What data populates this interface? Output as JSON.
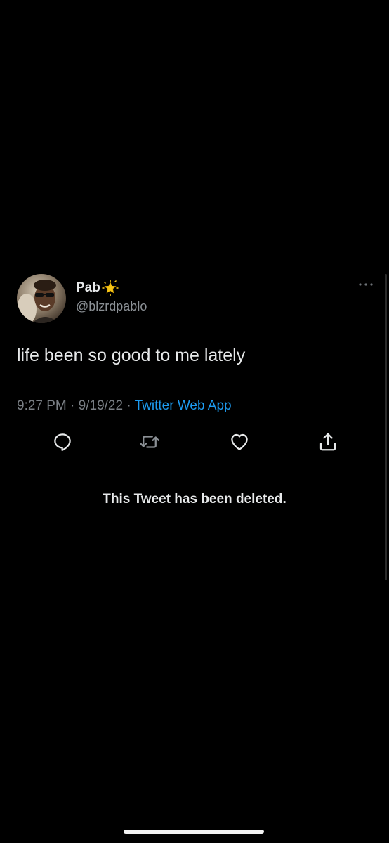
{
  "tweet": {
    "author": {
      "display_name": "Pab",
      "name_emoji": "glowing-star-emoji",
      "handle": "@blzrdpablo"
    },
    "text": "life been so good to me lately",
    "time": "9:27 PM",
    "separator": "·",
    "date": "9/19/22",
    "source": "Twitter Web App",
    "actions": [
      "reply-icon",
      "retweet-icon",
      "like-icon",
      "share-icon"
    ],
    "more_icon": "more-horizontal-icon"
  },
  "notice": "This Tweet has been deleted.",
  "colors": {
    "background": "#000000",
    "text": "#e7e9ea",
    "muted": "#7b8086",
    "link": "#1d9bf0",
    "star": "#f5c518"
  }
}
